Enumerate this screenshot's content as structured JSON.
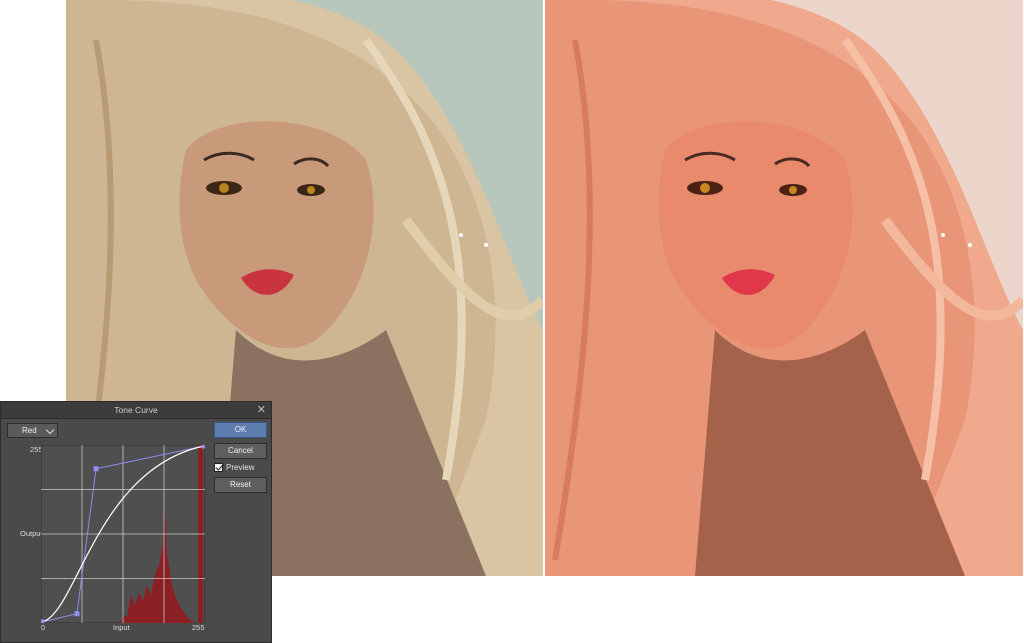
{
  "dialog": {
    "title": "Tone Curve",
    "close_glyph": "✕",
    "channel": "Red",
    "ok_label": "OK",
    "cancel_label": "Cancel",
    "preview_label": "Preview",
    "preview_checked": true,
    "reset_label": "Reset",
    "axis": {
      "max_label": "255",
      "output_label": "Output",
      "input_label": "Input",
      "zero_label": "0",
      "input_max_label": "255"
    }
  },
  "curve": {
    "control_points": [
      [
        0,
        0
      ],
      [
        55,
        12
      ],
      [
        85,
        222
      ],
      [
        255,
        255
      ]
    ]
  },
  "colors": {
    "dialog_bg": "#4a4a4a",
    "graph_bg": "#4f4f4f",
    "histogram": "#8a1f24",
    "curve": "#ffffff",
    "handles": "#8f8ff0",
    "ok_button": "#5d7db0"
  },
  "images": {
    "left": "original-illustration",
    "right": "red-curve-adjusted-illustration"
  }
}
